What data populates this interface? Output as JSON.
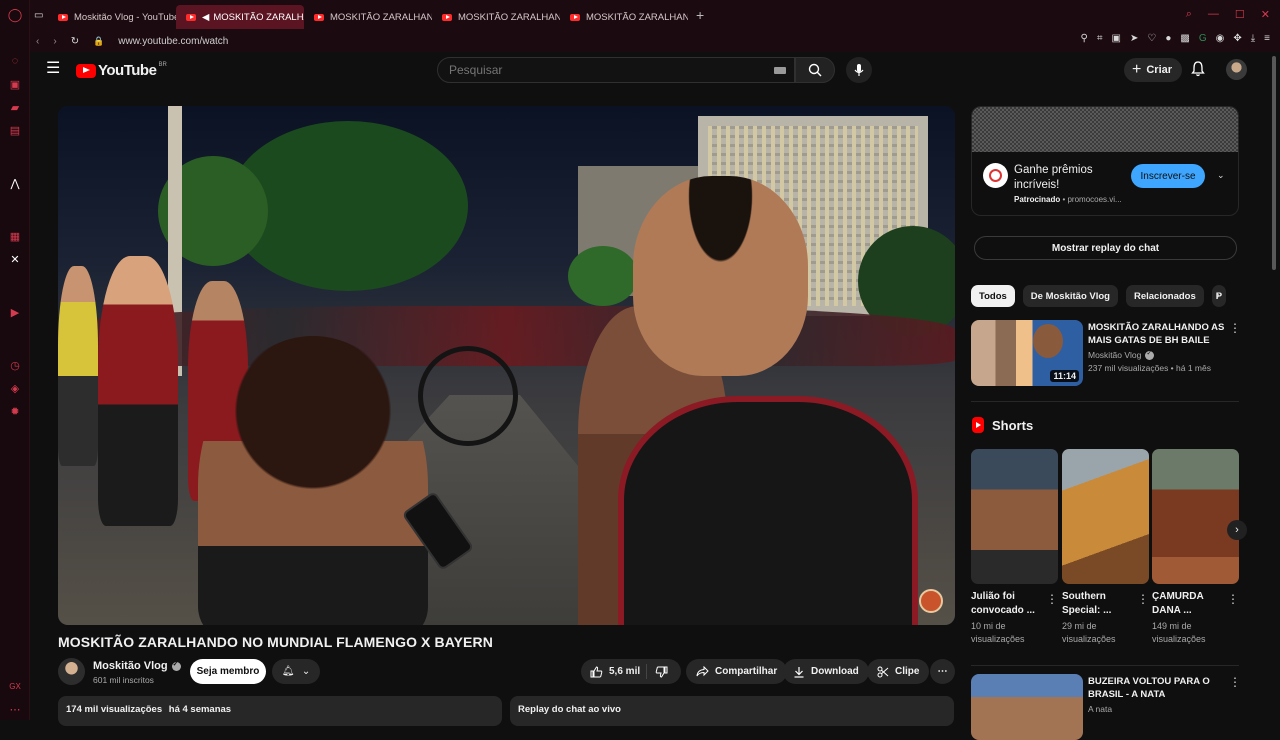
{
  "browser": {
    "tabs": [
      {
        "label": "Moskitão Vlog - YouTube",
        "active": false
      },
      {
        "label": "MOSKITÃO ZARALHANDO",
        "active": true
      },
      {
        "label": "MOSKITÃO ZARALHANDO",
        "active": false
      },
      {
        "label": "MOSKITÃO ZARALHANDO",
        "active": false
      },
      {
        "label": "MOSKITÃO ZARALHANDO",
        "active": false
      }
    ],
    "url": "www.youtube.com/watch",
    "accent": "#d63a4f"
  },
  "header": {
    "logo_text": "YouTube",
    "region": "BR",
    "search_placeholder": "Pesquisar",
    "create_label": "Criar"
  },
  "video": {
    "title": "MOSKITÃO ZARALHANDO NO MUNDIAL FLAMENGO X BAYERN",
    "channel": "Moskitão Vlog",
    "subscribers": "601 mil inscritos",
    "member_label": "Seja membro",
    "likes": "5,6 mil",
    "share_label": "Compartilhar",
    "download_label": "Download",
    "clip_label": "Clipe",
    "views": "174 mil visualizações",
    "age": "há 4 semanas",
    "replay_label": "Replay do chat ao vivo"
  },
  "ad": {
    "title": "Ganhe prêmios incríveis!",
    "sponsored": "Patrocinado",
    "domain": "promocoes.vi...",
    "subscribe_label": "Inscrever-se"
  },
  "chat_replay_button": "Mostrar replay do chat",
  "chips": [
    "Todos",
    "De Moskitão Vlog",
    "Relacionados",
    "P"
  ],
  "recommended": [
    {
      "title": "MOSKITÃO ZARALHANDO AS MAIS GATAS DE BH BAILE",
      "channel": "Moskitão Vlog",
      "meta": "237 mil visualizações • há 1 mês",
      "duration": "11:14"
    },
    {
      "title": "BUZEIRA VOLTOU PARA O BRASIL - A NATA",
      "channel": "A nata",
      "meta": "",
      "duration": ""
    }
  ],
  "shorts_title": "Shorts",
  "shorts": [
    {
      "title": "Julião foi convocado ...",
      "views": "10 mi de visualizações"
    },
    {
      "title": "Southern Special: ...",
      "views": "29 mi de visualizações"
    },
    {
      "title": "ÇAMURDA DANA ...",
      "views": "149 mi de visualizações"
    }
  ]
}
